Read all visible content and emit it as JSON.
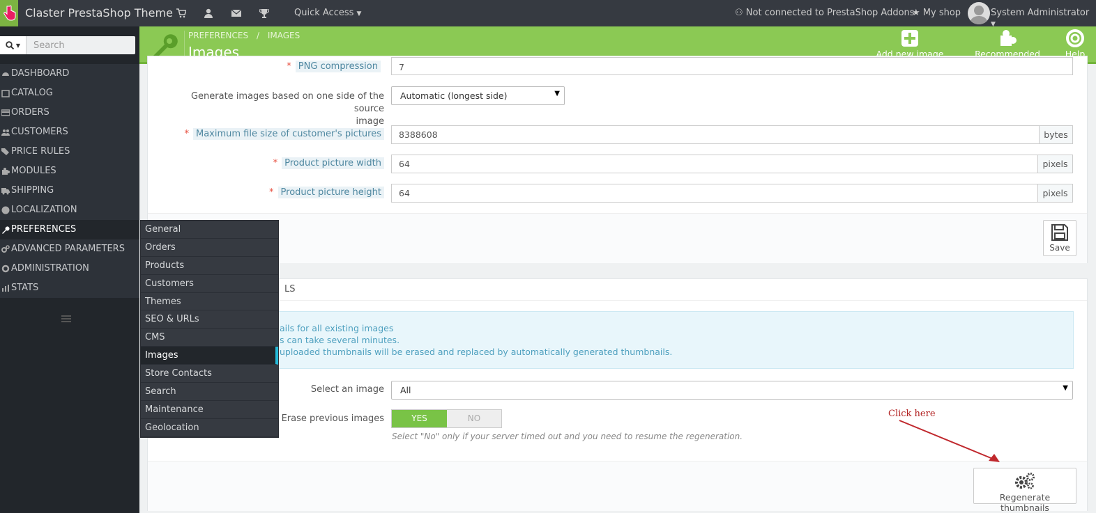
{
  "topbar": {
    "shop_name": "Claster PrestaShop Theme",
    "quick_access": "Quick Access",
    "addons_status": "Not connected to PrestaShop Addons",
    "my_shop": "My shop",
    "user": "System Administrator",
    "icons": [
      "cart-icon",
      "user-icon",
      "envelope-icon",
      "trophy-icon"
    ]
  },
  "sidebar": {
    "search_placeholder": "Search",
    "items": [
      {
        "label": "DASHBOARD",
        "icon": "dashboard-icon"
      },
      {
        "label": "CATALOG",
        "icon": "catalog-icon"
      },
      {
        "label": "ORDERS",
        "icon": "orders-icon"
      },
      {
        "label": "CUSTOMERS",
        "icon": "customers-icon"
      },
      {
        "label": "PRICE RULES",
        "icon": "tags-icon"
      },
      {
        "label": "MODULES",
        "icon": "puzzle-icon"
      },
      {
        "label": "SHIPPING",
        "icon": "truck-icon"
      },
      {
        "label": "LOCALIZATION",
        "icon": "globe-icon"
      },
      {
        "label": "PREFERENCES",
        "icon": "wrench-icon"
      },
      {
        "label": "ADVANCED PARAMETERS",
        "icon": "cogs-icon"
      },
      {
        "label": "ADMINISTRATION",
        "icon": "gear-icon"
      },
      {
        "label": "STATS",
        "icon": "bar-chart-icon"
      }
    ]
  },
  "submenu": {
    "items": [
      "General",
      "Orders",
      "Products",
      "Customers",
      "Themes",
      "SEO & URLs",
      "CMS",
      "Images",
      "Store Contacts",
      "Search",
      "Maintenance",
      "Geolocation"
    ],
    "active": "Images"
  },
  "header": {
    "breadcrumb": [
      "PREFERENCES",
      "/",
      "IMAGES"
    ],
    "title": "Images",
    "buttons": {
      "add": "Add new image type",
      "modules": "Recommended Modules",
      "help": "Help"
    }
  },
  "form1": {
    "png_label": "PNG compression",
    "png_value": "7",
    "generate_label_1": "Generate images based on one side of the source",
    "generate_label_2": "image",
    "generate_value": "Automatic (longest side)",
    "maxsize_label": "Maximum file size of customer's pictures",
    "maxsize_value": "8388608",
    "maxsize_unit": "bytes",
    "width_label": "Product picture width",
    "width_value": "64",
    "width_unit": "pixels",
    "height_label": "Product picture height",
    "height_value": "64",
    "height_unit": "pixels",
    "save": "Save"
  },
  "form2": {
    "heading": "LS",
    "alert_lines": [
      "ails for all existing images",
      "s can take several minutes.",
      "uploaded thumbnails will be erased and replaced by automatically generated thumbnails."
    ],
    "select_label": "Select an image",
    "select_value": "All",
    "erase_label": "Erase previous images",
    "yes": "YES",
    "no": "NO",
    "hint": "Select \"No\" only if your server timed out and you need to resume the regeneration.",
    "regenerate": "Regenerate thumbnails"
  },
  "annotation": {
    "text": "Click here",
    "color": "#b22222"
  },
  "colors": {
    "header_green": "#8bc954",
    "sidebar_dark": "#22262b",
    "toggle_yes": "#79c346",
    "active_marker": "#25b9d7"
  }
}
